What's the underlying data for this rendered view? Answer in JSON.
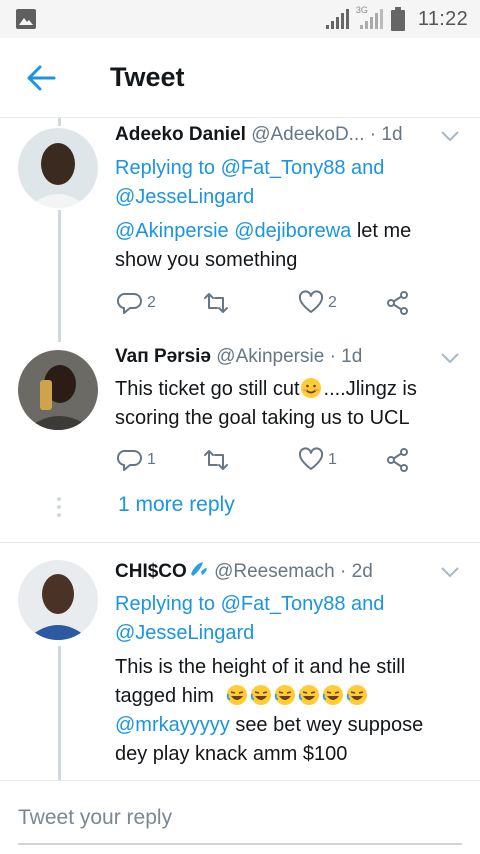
{
  "status_bar": {
    "time": "11:22",
    "network": "3G"
  },
  "header": {
    "title": "Tweet"
  },
  "tweets": [
    {
      "name": "Adeeko Daniel",
      "handle": "@AdeekoD...",
      "time": "· 1d",
      "replying_prefix": "Replying to",
      "replying_user1": "@Fat_Tony88",
      "replying_and": "and",
      "replying_user2": "@JesseLingard",
      "mention1": "@Akinpersie",
      "mention2": "@dejiborewa",
      "text_rest1": "let me",
      "text_rest2": "show you something",
      "replies": "2",
      "retweets": "",
      "likes": "2"
    },
    {
      "name": "Vaп Pərsiə",
      "handle": "@Akinpersie",
      "time": "· 1d",
      "line1a": "This ticket go still cut",
      "line1b": "....Jlingz is",
      "line2": "scoring the goal taking us to UCL",
      "replies": "1",
      "retweets": "",
      "likes": "1"
    },
    {
      "name": "CHI$CO",
      "handle": "@Reesemach",
      "time": "· 2d",
      "replying_prefix": "Replying to",
      "replying_user1": "@Fat_Tony88",
      "replying_and": "and",
      "replying_user2": "@JesseLingard",
      "line1": "This is the height of it and he still",
      "line2": "tagged him",
      "mention": "@mrkayyyyy",
      "line3_rest": "see bet wey suppose",
      "line4": "dey play knack amm $100"
    }
  ],
  "more_replies": "1 more reply",
  "reply_bar": {
    "placeholder": "Tweet your reply"
  },
  "colors": {
    "accent": "#1b95e0",
    "text": "#14171a",
    "muted": "#657786",
    "line": "#cfd9de"
  },
  "icons": [
    "image-icon",
    "signal-icon",
    "battery-icon",
    "back-arrow-icon",
    "chevron-down-icon",
    "reply-icon",
    "retweet-icon",
    "like-icon",
    "share-icon",
    "emoji-icon",
    "water-drop-icon"
  ]
}
